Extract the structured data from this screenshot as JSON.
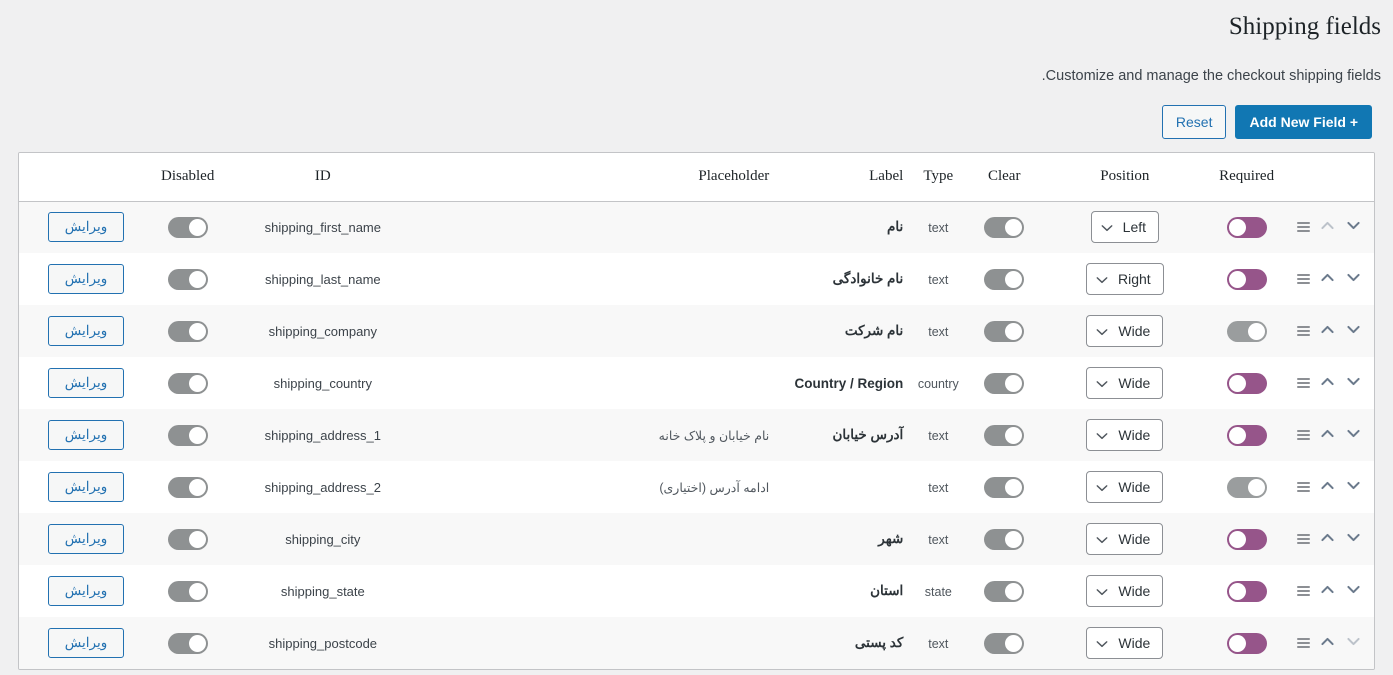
{
  "header": {
    "title": "Shipping fields",
    "description": ".Customize and manage the checkout shipping fields",
    "reset_label": "Reset",
    "add_label": "Add New Field +"
  },
  "colors": {
    "accent_blue": "#1177b3",
    "link_blue": "#2271b1",
    "toggle_on_purple": "#96558a",
    "toggle_off_gray": "#8e9192",
    "row_alt_bg": "#f8f8f8",
    "page_bg": "#f0f0f1",
    "border": "#c3c4c7"
  },
  "table": {
    "columns": [
      {
        "key": "edit",
        "label": ""
      },
      {
        "key": "disabled",
        "label": "Disabled"
      },
      {
        "key": "id",
        "label": "ID"
      },
      {
        "key": "placeholder",
        "label": "Placeholder"
      },
      {
        "key": "label",
        "label": "Label"
      },
      {
        "key": "type",
        "label": "Type"
      },
      {
        "key": "clear",
        "label": "Clear"
      },
      {
        "key": "position",
        "label": "Position"
      },
      {
        "key": "required",
        "label": "Required"
      },
      {
        "key": "move",
        "label": ""
      }
    ],
    "edit_button_label": "ویرایش",
    "rows": [
      {
        "id": "shipping_first_name",
        "placeholder": "",
        "label": "نام",
        "type": "text",
        "position": "Left",
        "disabled_on": false,
        "clear_on": false,
        "required_on": true,
        "can_move_up": false,
        "can_move_down": true
      },
      {
        "id": "shipping_last_name",
        "placeholder": "",
        "label": "نام خانوادگی",
        "type": "text",
        "position": "Right",
        "disabled_on": false,
        "clear_on": false,
        "required_on": true,
        "can_move_up": true,
        "can_move_down": true
      },
      {
        "id": "shipping_company",
        "placeholder": "",
        "label": "نام شرکت",
        "type": "text",
        "position": "Wide",
        "disabled_on": false,
        "clear_on": false,
        "required_on": false,
        "can_move_up": true,
        "can_move_down": true
      },
      {
        "id": "shipping_country",
        "placeholder": "",
        "label": "Country / Region",
        "type": "country",
        "position": "Wide",
        "disabled_on": false,
        "clear_on": false,
        "required_on": true,
        "can_move_up": true,
        "can_move_down": true
      },
      {
        "id": "shipping_address_1",
        "placeholder": "نام خیابان و پلاک خانه",
        "label": "آدرس خیابان",
        "type": "text",
        "position": "Wide",
        "disabled_on": false,
        "clear_on": false,
        "required_on": true,
        "can_move_up": true,
        "can_move_down": true
      },
      {
        "id": "shipping_address_2",
        "placeholder": "ادامه آدرس (اختیاری)",
        "label": "",
        "type": "text",
        "position": "Wide",
        "disabled_on": false,
        "clear_on": false,
        "required_on": false,
        "can_move_up": true,
        "can_move_down": true
      },
      {
        "id": "shipping_city",
        "placeholder": "",
        "label": "شهر",
        "type": "text",
        "position": "Wide",
        "disabled_on": false,
        "clear_on": false,
        "required_on": true,
        "can_move_up": true,
        "can_move_down": true
      },
      {
        "id": "shipping_state",
        "placeholder": "",
        "label": "استان",
        "type": "state",
        "position": "Wide",
        "disabled_on": false,
        "clear_on": false,
        "required_on": true,
        "can_move_up": true,
        "can_move_down": true
      },
      {
        "id": "shipping_postcode",
        "placeholder": "",
        "label": "کد پستی",
        "type": "text",
        "position": "Wide",
        "disabled_on": false,
        "clear_on": false,
        "required_on": true,
        "can_move_up": true,
        "can_move_down": false
      }
    ]
  },
  "icons": {
    "chevron_down": "chevron-down-icon",
    "chevron_up": "chevron-up-icon",
    "drag_handle": "drag-handle-icon"
  }
}
